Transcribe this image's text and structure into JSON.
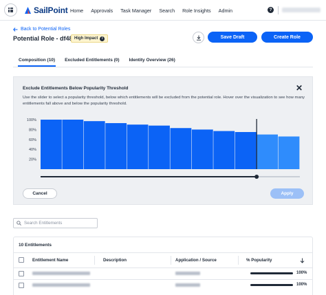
{
  "brand": {
    "name": "SailPoint",
    "accent": "#0b63f6",
    "logo_colors": [
      "#0b63f6",
      "#e74c3c"
    ]
  },
  "nav": {
    "menu_icon": "grid-dots-icon",
    "items": [
      "Home",
      "Approvals",
      "Task Manager",
      "Search",
      "Role Insights",
      "Admin"
    ],
    "help_icon": "help-circle-icon",
    "help_glyph": "?"
  },
  "header": {
    "back_label": "Back to Potential Roles",
    "title": "Potential Role - df482e",
    "impact_badge": "High Impact",
    "impact_info_glyph": "i",
    "download_icon": "download-icon",
    "save_label": "Save Draft",
    "create_label": "Create Role"
  },
  "tabs": [
    {
      "label": "Composition (10)",
      "active": true
    },
    {
      "label": "Excluded Entitlements (0)",
      "active": false
    },
    {
      "label": "Identity Overview (26)",
      "active": false
    }
  ],
  "panel": {
    "title": "Exclude Entitlements Below Popularity Threshold",
    "description": "Use the slider to select a popularity threshold, below which entitlements will be excluded from the potential role. Hover over the visualization to see how many entitlements fall above and below the popularity threshold.",
    "close_glyph": "✕",
    "cancel_label": "Cancel",
    "apply_label": "Apply"
  },
  "chart_data": {
    "type": "bar",
    "y_ticks": [
      "100%",
      "80%",
      "60%",
      "40%",
      "20%"
    ],
    "ylim": [
      0,
      100
    ],
    "values": [
      100,
      100,
      97,
      93,
      90,
      88,
      83,
      80,
      77,
      75,
      70,
      66
    ],
    "threshold_after_index": 9,
    "colors": {
      "above": "#0b63f6",
      "below": "#2f8cfc"
    }
  },
  "search": {
    "placeholder": "Search Entitlements"
  },
  "table": {
    "count_label": "10 Entitlements",
    "columns": [
      "Entitlement Name",
      "Description",
      "Application / Source",
      "% Popularity"
    ],
    "sort_icon": "arrow-down-icon",
    "rows": [
      {
        "popularity": "100%"
      },
      {
        "popularity": "100%"
      }
    ]
  }
}
